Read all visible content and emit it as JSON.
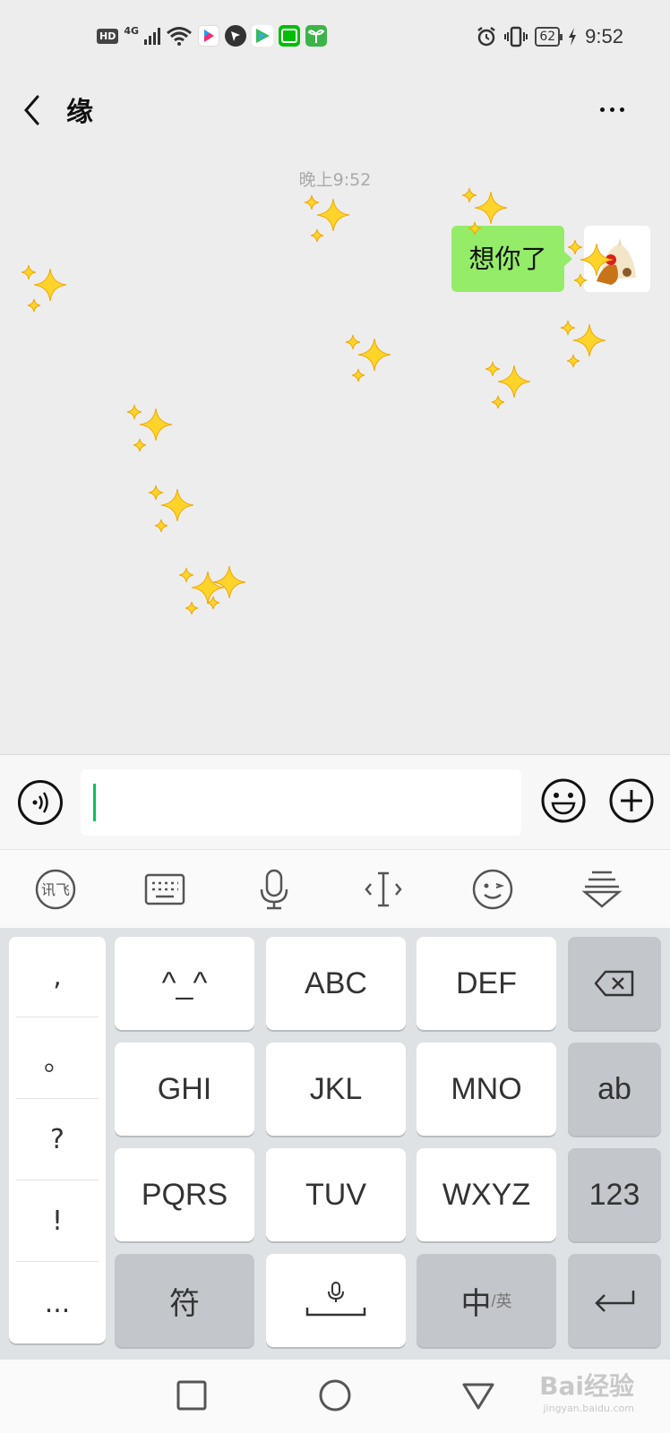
{
  "status_bar": {
    "hd": "HD",
    "network": "4G",
    "battery": "62",
    "time": "9:52",
    "icons": [
      "signal-icon",
      "wifi-icon",
      "youku-icon",
      "qq-browser-icon",
      "tencent-video-icon",
      "iqiyi-icon",
      "app-icon",
      "alarm-icon",
      "vibrate-icon",
      "battery-icon",
      "charging-icon"
    ]
  },
  "header": {
    "title": "缘"
  },
  "chat": {
    "timestamp": "晚上9:52",
    "messages": [
      {
        "side": "right",
        "text": "想你了"
      }
    ]
  },
  "input_bar": {
    "value": ""
  },
  "keyboard": {
    "punctuation": [
      ",",
      "。",
      "?",
      "!",
      "..."
    ],
    "rows": [
      [
        "^_^",
        "ABC",
        "DEF"
      ],
      [
        "GHI",
        "JKL",
        "MNO"
      ],
      [
        "PQRS",
        "TUV",
        "WXYZ"
      ]
    ],
    "side_keys": [
      "ab",
      "123"
    ],
    "bottom": {
      "symbol": "符",
      "lang_main": "中",
      "lang_alt": "/英"
    }
  },
  "watermark": {
    "main": "Bai经验",
    "sub": "jingyan.baidu.com"
  },
  "colors": {
    "bubble": "#95ec69",
    "caret": "#07c160",
    "background": "#ededed"
  }
}
